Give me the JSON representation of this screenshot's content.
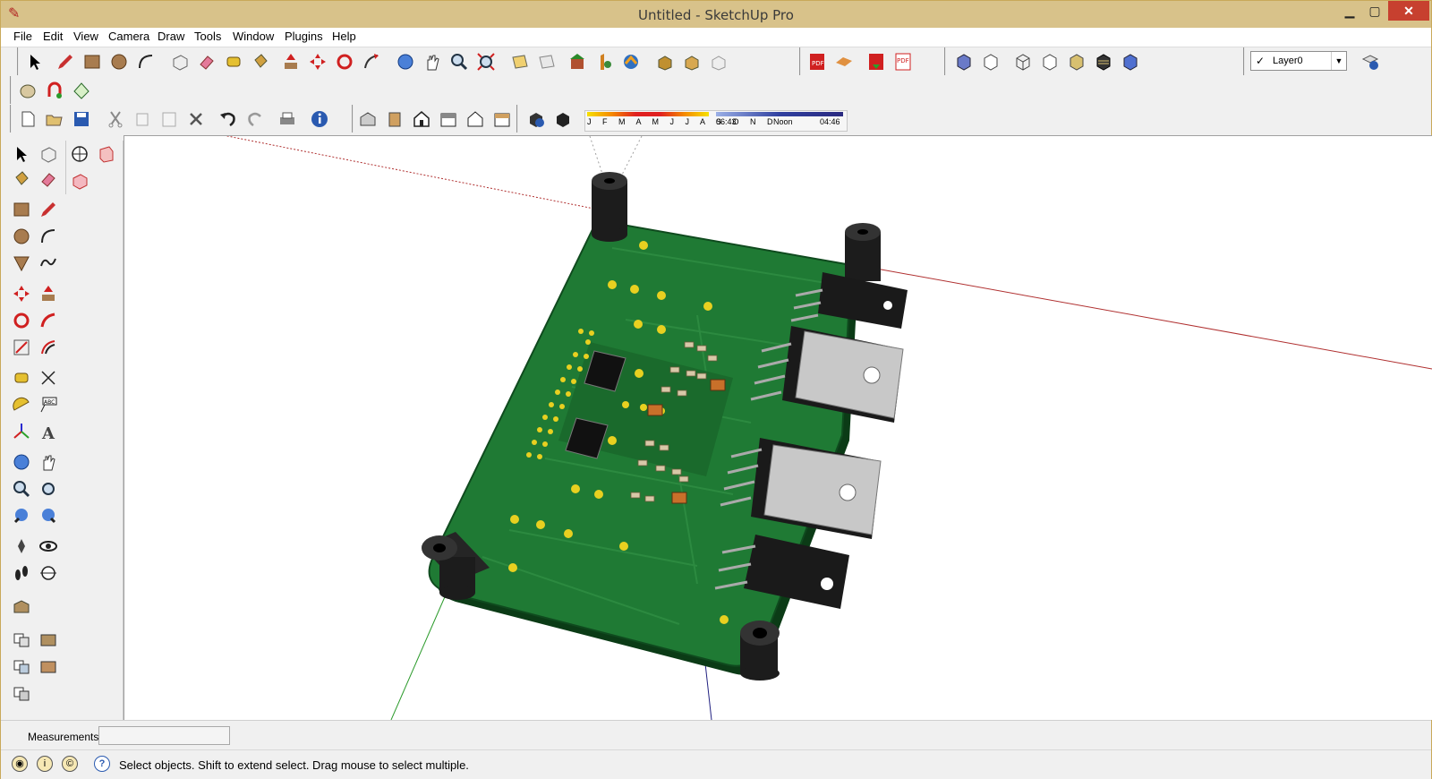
{
  "window": {
    "title": "Untitled - SketchUp Pro",
    "app_icon": "sketchup-logo-icon"
  },
  "menu": [
    "File",
    "Edit",
    "View",
    "Camera",
    "Draw",
    "Tools",
    "Window",
    "Plugins",
    "Help"
  ],
  "layer": {
    "checked": "✓",
    "name": "Layer0"
  },
  "shadow": {
    "months": "J F M A M J J A S O N D",
    "time_start": "06:43",
    "time_mid": "Noon",
    "time_end": "04:46"
  },
  "measurements": {
    "label": "Measurements",
    "value": ""
  },
  "status": {
    "text": "Select objects. Shift to extend select. Drag mouse to select multiple."
  },
  "colors": {
    "title_bar": "#d8c28a",
    "close": "#c7402f",
    "pcb": "#1f7a34",
    "axis_red": "#b03030",
    "axis_green": "#2a9a2a",
    "axis_blue": "#202080"
  }
}
